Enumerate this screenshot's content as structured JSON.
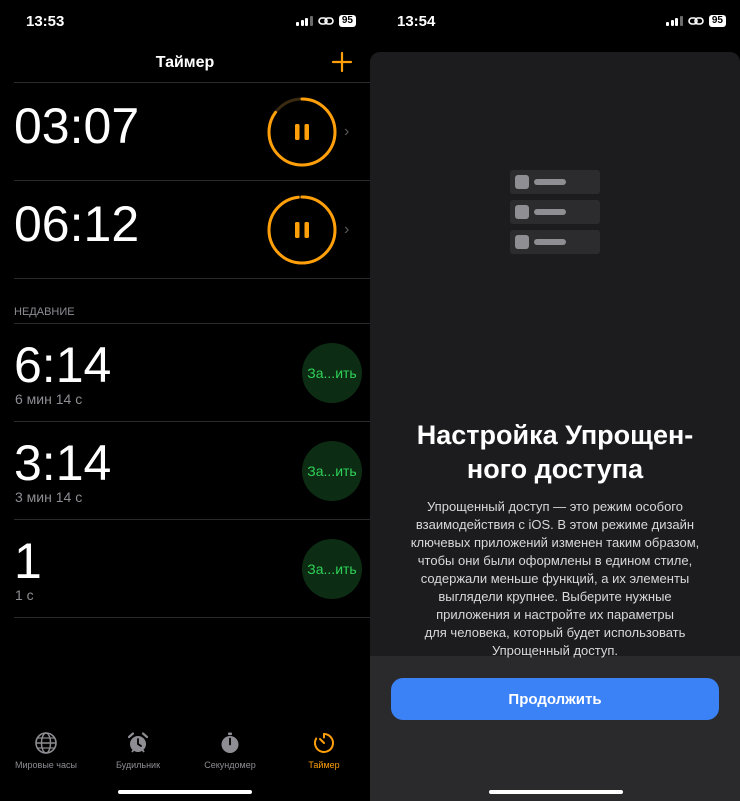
{
  "left": {
    "status": {
      "time": "13:53",
      "battery": "95"
    },
    "nav": {
      "title": "Таймер",
      "add_icon": "plus-icon"
    },
    "timers": [
      {
        "time": "03:07",
        "progress": 0.85
      },
      {
        "time": "06:12",
        "progress": 0.98
      }
    ],
    "recent_label": "НЕДАВНИЕ",
    "recent": [
      {
        "time": "6:14",
        "sub": "6 мин 14 с",
        "button": "За...ить"
      },
      {
        "time": "3:14",
        "sub": "3 мин 14 с",
        "button": "За...ить"
      },
      {
        "time": "1",
        "sub": "1 с",
        "button": "За...ить"
      }
    ],
    "tabs": [
      {
        "label": "Мировые часы",
        "icon": "globe-icon",
        "active": false
      },
      {
        "label": "Будильник",
        "icon": "alarm-clock-icon",
        "active": false
      },
      {
        "label": "Секундомер",
        "icon": "stopwatch-icon",
        "active": false
      },
      {
        "label": "Таймер",
        "icon": "timer-icon",
        "active": true
      }
    ],
    "colors": {
      "accent": "#ff9f0a",
      "start_green": "#30d158",
      "start_bg": "#0c2d13"
    }
  },
  "right": {
    "status": {
      "time": "13:54",
      "battery": "95"
    },
    "sheet": {
      "title_line1": "Настройка Упрощен-",
      "title_line2": "ного доступа",
      "body": [
        "Упрощенный доступ — это режим особого",
        "взаимодействия с iOS. В этом режиме дизайн",
        "ключевых приложений изменен таким образом,",
        "чтобы они были оформлены в едином стиле,",
        "содержали меньше функций, а их элементы",
        "выглядели крупнее. Выберите нужные",
        "приложения и настройте их параметры",
        "для человека, который будет использовать",
        "Упрощенный доступ."
      ],
      "button": "Продолжить"
    },
    "colors": {
      "button_blue": "#3b82f6"
    }
  }
}
